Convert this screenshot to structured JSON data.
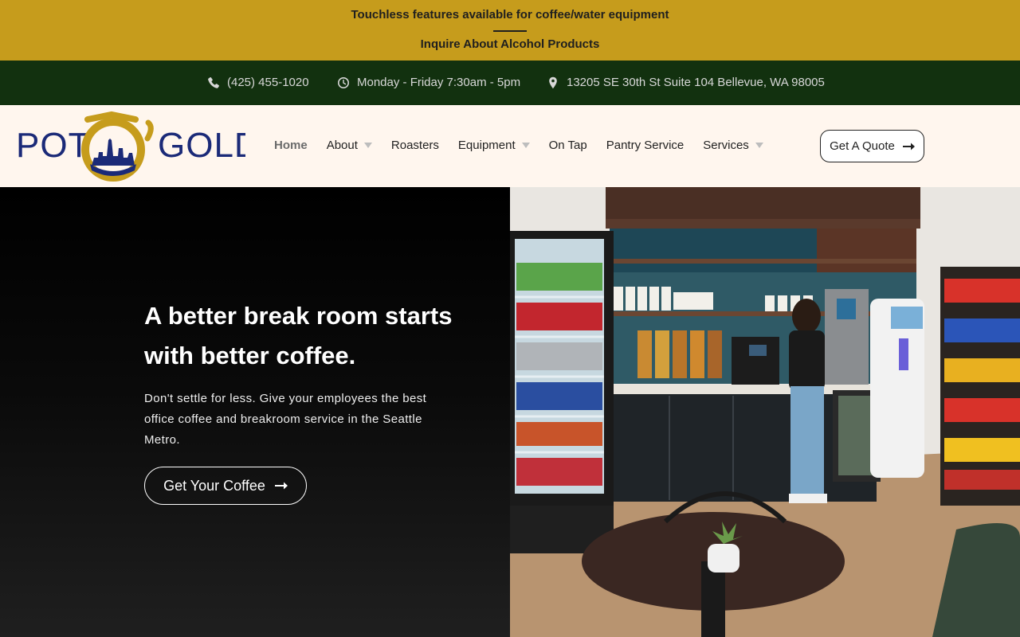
{
  "announcement": {
    "line1": "Touchless features available for coffee/water equipment",
    "line2": "Inquire About Alcohol Products"
  },
  "contact": {
    "phone": "(425) 455-1020",
    "hours": "Monday - Friday 7:30am - 5pm",
    "address": "13205 SE 30th St Suite 104 Bellevue, WA 98005",
    "icons": [
      "phone-icon",
      "clock-icon",
      "map-pin-icon"
    ]
  },
  "brand": {
    "name": "POT O'GOLD",
    "colors": {
      "navy": "#1b2a78",
      "gold": "#c69c1c",
      "dark_green": "#12310f",
      "cream": "#fff6ee"
    }
  },
  "nav": {
    "items": [
      {
        "label": "Home",
        "active": true,
        "dropdown": false
      },
      {
        "label": "About",
        "active": false,
        "dropdown": true
      },
      {
        "label": "Roasters",
        "active": false,
        "dropdown": false
      },
      {
        "label": "Equipment",
        "active": false,
        "dropdown": true
      },
      {
        "label": "On Tap",
        "active": false,
        "dropdown": false
      },
      {
        "label": "Pantry Service",
        "active": false,
        "dropdown": false
      },
      {
        "label": "Services",
        "active": false,
        "dropdown": true
      }
    ],
    "quote_label": "Get A Quote"
  },
  "hero": {
    "title": "A better break room starts with better coffee.",
    "text": "Don't settle for less. Give your employees the best office coffee and breakroom service in the Seattle Metro.",
    "cta_label": "Get Your Coffee"
  }
}
